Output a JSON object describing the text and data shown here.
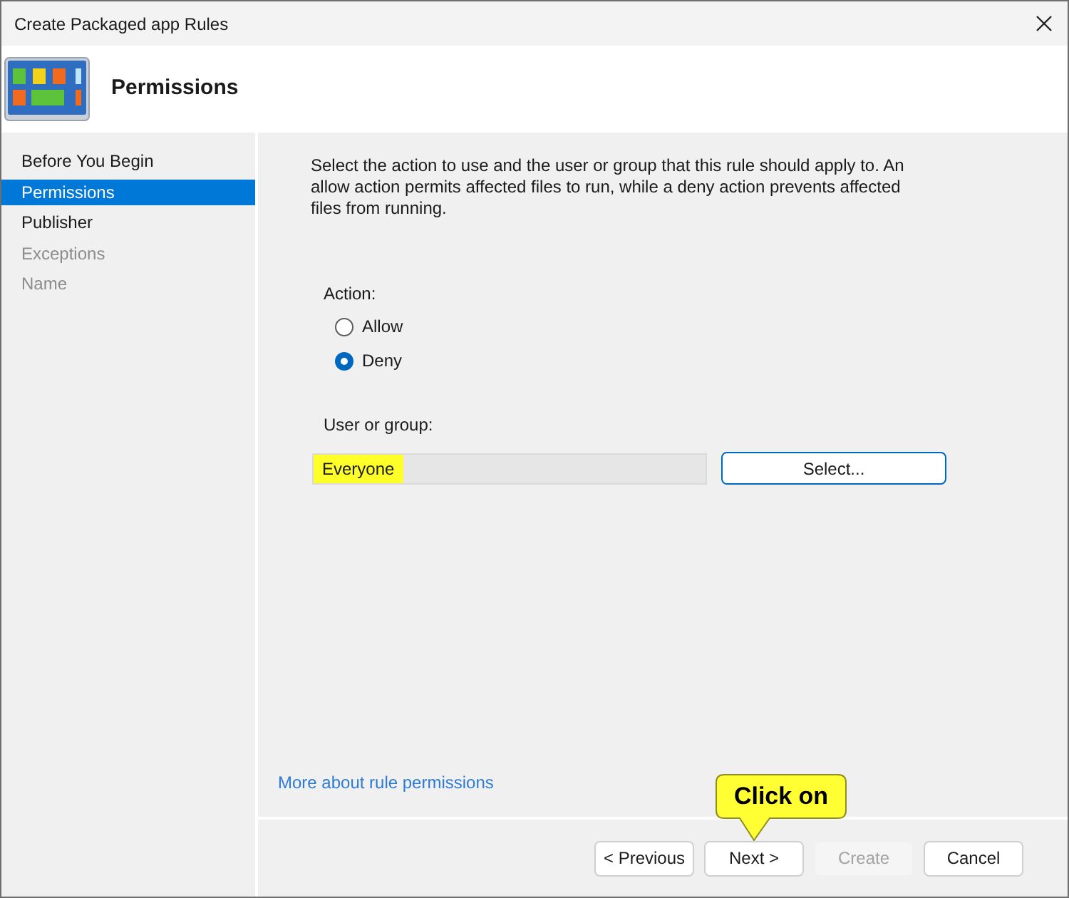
{
  "window": {
    "title": "Create Packaged app Rules"
  },
  "header": {
    "title": "Permissions"
  },
  "steps": [
    {
      "label": "Before You Begin",
      "selected": false,
      "disabled": false
    },
    {
      "label": "Permissions",
      "selected": true,
      "disabled": false
    },
    {
      "label": "Publisher",
      "selected": false,
      "disabled": false
    },
    {
      "label": "Exceptions",
      "selected": false,
      "disabled": true
    },
    {
      "label": "Name",
      "selected": false,
      "disabled": true
    }
  ],
  "description": "Select the action to use and the user or group that this rule should apply to. An allow action permits affected files to run, while a deny action prevents affected files from running.",
  "action": {
    "label": "Action:",
    "options": [
      {
        "label": "Allow",
        "selected": false
      },
      {
        "label": "Deny",
        "selected": true
      }
    ]
  },
  "user_or_group": {
    "label": "User or group:",
    "value": "Everyone",
    "highlighted": true,
    "button": {
      "label": "Select..."
    }
  },
  "link": {
    "label": "More about rule permissions"
  },
  "callout": {
    "text": "Click on"
  },
  "buttons": [
    {
      "label": "< Previous",
      "disabled": false
    },
    {
      "label": "Next >",
      "disabled": false
    },
    {
      "label": "Create",
      "disabled": true
    },
    {
      "label": "Cancel",
      "disabled": false
    }
  ]
}
